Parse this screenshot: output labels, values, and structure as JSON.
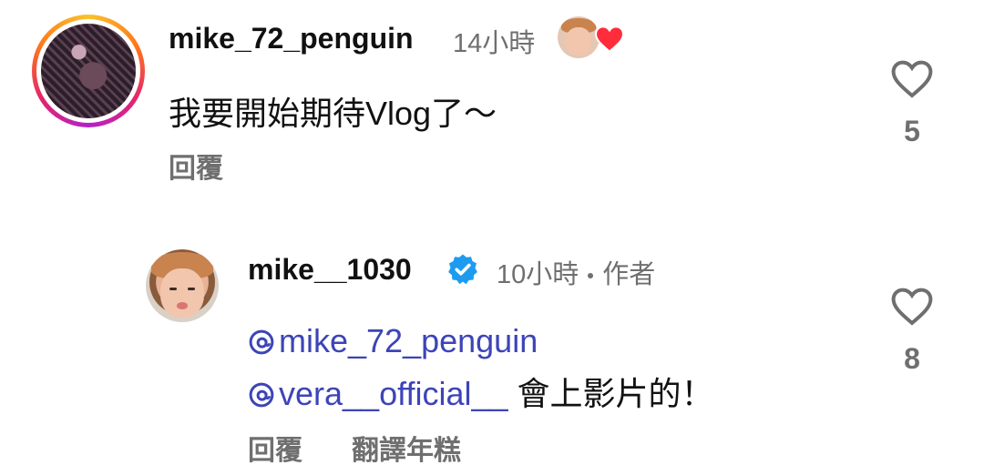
{
  "comments": [
    {
      "username": "mike_72_penguin",
      "time": "14小時",
      "text": "我要開始期待Vlog了～",
      "reply_label": "回覆",
      "like_count": "5",
      "author_liked": true
    },
    {
      "username": "mike__1030",
      "time": "10小時",
      "author_tag": "作者",
      "verified": true,
      "mention_1": "mike_72_penguin",
      "mention_2": "vera__official__",
      "text_after_mention": " 會上影片的！",
      "reply_label": "回覆",
      "translate_label": "翻譯年糕",
      "like_count": "8"
    }
  ],
  "icons": {
    "like": "heart-outline-icon",
    "verified": "verified-badge-icon",
    "mention": "threads-at-icon",
    "author_like": "heart-filled-icon"
  },
  "colors": {
    "mention": "#3d44b8",
    "verified": "#1d9bf0",
    "heart": "#ff2d3b",
    "secondary_text": "#6f6f6f"
  }
}
